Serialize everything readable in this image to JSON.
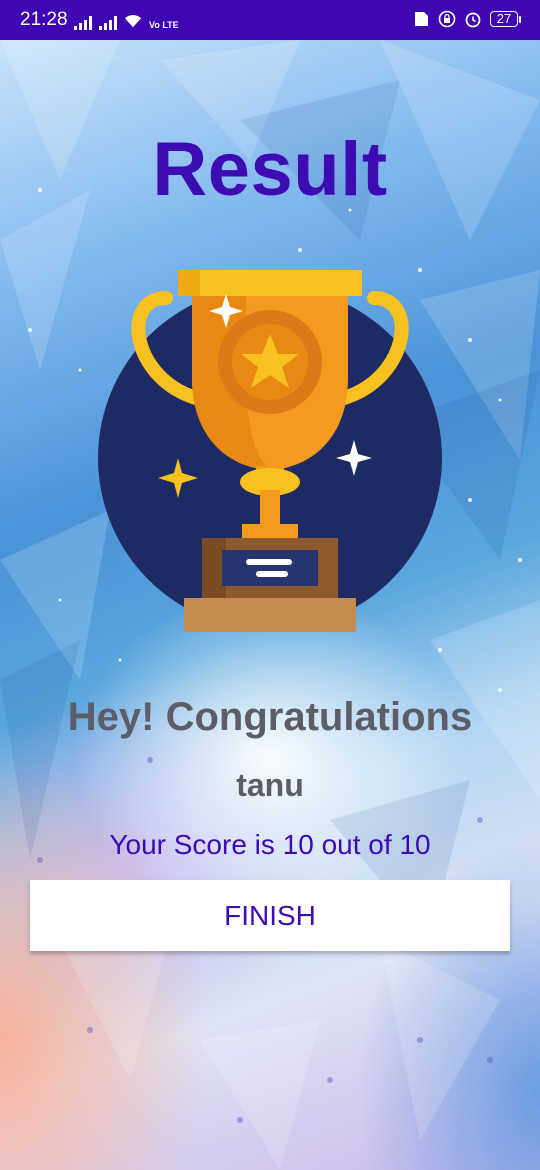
{
  "status_bar": {
    "time": "21:28",
    "network_label": "Vo LTE",
    "battery": "27"
  },
  "result": {
    "title": "Result",
    "congrats": "Hey! Congratulations",
    "username": "tanu",
    "score_text": "Your Score is 10 out of 10",
    "finish_label": "FINISH"
  },
  "colors": {
    "status_bar": "#3e07b3",
    "title": "#3d0bb2",
    "text_gray": "#5d5d68",
    "trophy_circle": "#1e2a63",
    "trophy_gold": "#f7a72a"
  }
}
